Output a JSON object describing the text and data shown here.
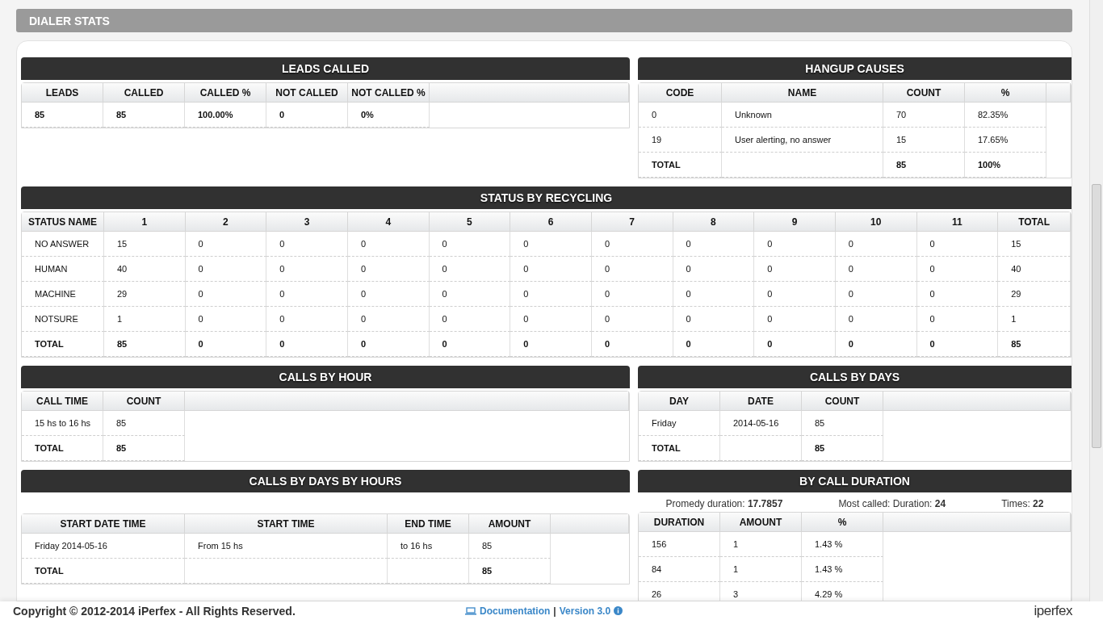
{
  "page_title": "DIALER STATS",
  "leads_called": {
    "title": "LEADS CALLED",
    "columns": [
      "LEADS",
      "CALLED",
      "CALLED %",
      "NOT CALLED",
      "NOT CALLED %"
    ],
    "rows": [
      {
        "bold": true,
        "cells": [
          "85",
          "85",
          "100.00%",
          "0",
          "0%"
        ]
      }
    ]
  },
  "hangup_causes": {
    "title": "HANGUP CAUSES",
    "columns": [
      "CODE",
      "NAME",
      "COUNT",
      "%"
    ],
    "rows": [
      {
        "bold": false,
        "cells": [
          "0",
          "Unknown",
          "70",
          "82.35%"
        ]
      },
      {
        "bold": false,
        "cells": [
          "19",
          "User alerting, no answer",
          "15",
          "17.65%"
        ]
      },
      {
        "bold": true,
        "cells": [
          "TOTAL",
          "",
          "85",
          "100%"
        ]
      }
    ]
  },
  "status_by_recycling": {
    "title": "STATUS BY RECYCLING",
    "columns": [
      "STATUS NAME",
      "1",
      "2",
      "3",
      "4",
      "5",
      "6",
      "7",
      "8",
      "9",
      "10",
      "11",
      "TOTAL"
    ],
    "rows": [
      {
        "bold": false,
        "cells": [
          "NO ANSWER",
          "15",
          "0",
          "0",
          "0",
          "0",
          "0",
          "0",
          "0",
          "0",
          "0",
          "0",
          "15"
        ]
      },
      {
        "bold": false,
        "cells": [
          "HUMAN",
          "40",
          "0",
          "0",
          "0",
          "0",
          "0",
          "0",
          "0",
          "0",
          "0",
          "0",
          "40"
        ]
      },
      {
        "bold": false,
        "cells": [
          "MACHINE",
          "29",
          "0",
          "0",
          "0",
          "0",
          "0",
          "0",
          "0",
          "0",
          "0",
          "0",
          "29"
        ]
      },
      {
        "bold": false,
        "cells": [
          "NOTSURE",
          "1",
          "0",
          "0",
          "0",
          "0",
          "0",
          "0",
          "0",
          "0",
          "0",
          "0",
          "1"
        ]
      },
      {
        "bold": true,
        "cells": [
          "TOTAL",
          "85",
          "0",
          "0",
          "0",
          "0",
          "0",
          "0",
          "0",
          "0",
          "0",
          "0",
          "85"
        ]
      }
    ]
  },
  "calls_by_hour": {
    "title": "CALLS BY HOUR",
    "columns": [
      "CALL TIME",
      "COUNT"
    ],
    "rows": [
      {
        "bold": false,
        "cells": [
          "15 hs to 16 hs",
          "85"
        ]
      },
      {
        "bold": true,
        "cells": [
          "TOTAL",
          "85"
        ]
      }
    ]
  },
  "calls_by_days": {
    "title": "CALLS BY DAYS",
    "columns": [
      "DAY",
      "DATE",
      "COUNT"
    ],
    "rows": [
      {
        "bold": false,
        "cells": [
          "Friday",
          "2014-05-16",
          "85"
        ]
      },
      {
        "bold": true,
        "cells": [
          "TOTAL",
          "",
          "85"
        ]
      }
    ]
  },
  "calls_by_days_by_hours": {
    "title": "CALLS BY DAYS BY HOURS",
    "columns": [
      "START DATE TIME",
      "START TIME",
      "END TIME",
      "AMOUNT"
    ],
    "rows": [
      {
        "bold": false,
        "cells": [
          "Friday 2014-05-16",
          "From 15 hs",
          "to 16 hs",
          "85"
        ]
      },
      {
        "bold": true,
        "cells": [
          "TOTAL",
          "",
          "",
          "85"
        ]
      }
    ]
  },
  "by_call_duration": {
    "title": "BY CALL DURATION",
    "summary": [
      {
        "label": "Promedy duration:",
        "value": "17.7857"
      },
      {
        "label": "Most called: Duration:",
        "value": "24"
      },
      {
        "label": "Times:",
        "value": "22"
      }
    ],
    "columns": [
      "DURATION",
      "AMOUNT",
      "%"
    ],
    "rows": [
      {
        "bold": false,
        "cells": [
          "156",
          "1",
          "1.43 %"
        ]
      },
      {
        "bold": false,
        "cells": [
          "84",
          "1",
          "1.43 %"
        ]
      },
      {
        "bold": false,
        "cells": [
          "26",
          "3",
          "4.29 %"
        ]
      }
    ]
  },
  "footer": {
    "copyright": "Copyright © 2012-2014 iPerfex - All Rights Reserved.",
    "documentation": "Documentation",
    "separator": "|",
    "version": "Version 3.0",
    "logo": "iperfex"
  }
}
